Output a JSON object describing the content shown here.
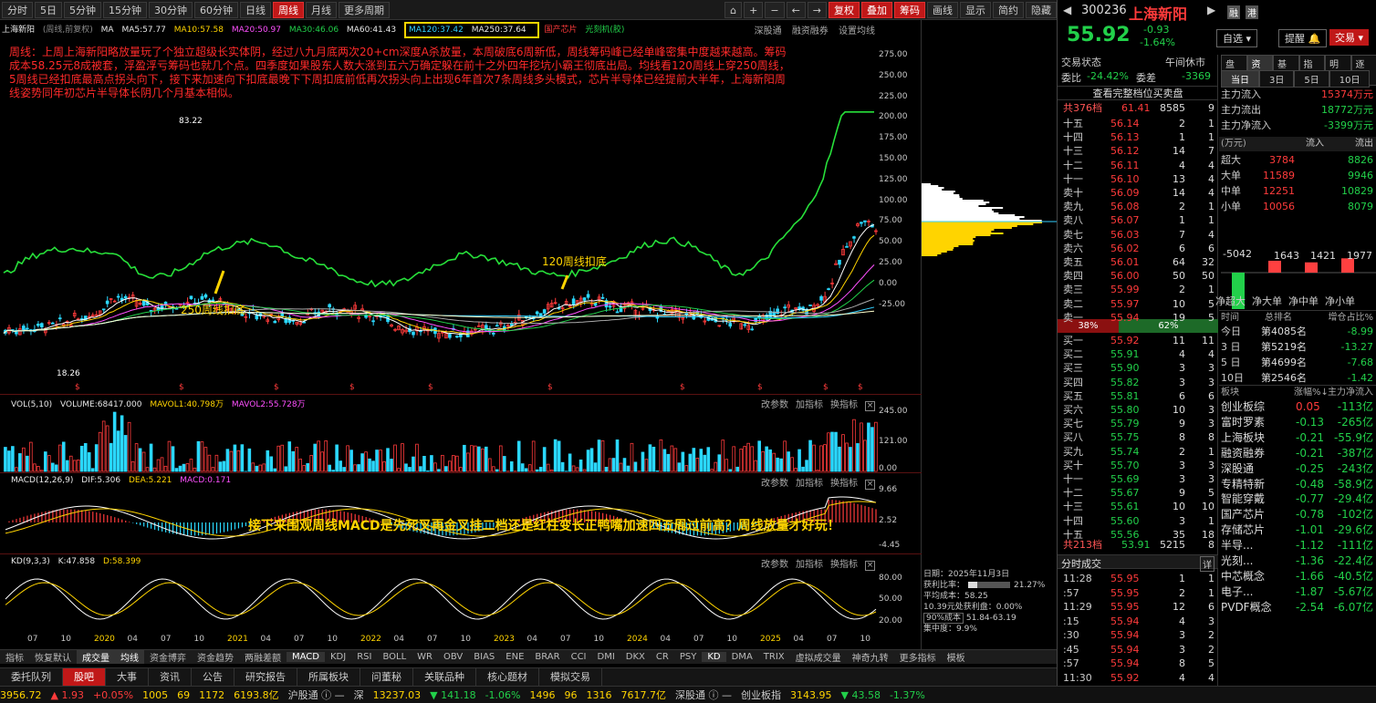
{
  "toolbar": {
    "items": [
      "分时",
      "5日",
      "5分钟",
      "15分钟",
      "30分钟",
      "60分钟",
      "日线",
      "周线",
      "月线",
      "更多周期"
    ],
    "right_items": [
      "复权",
      "叠加",
      "筹码",
      "画线",
      "显示",
      "简约",
      "隐藏"
    ]
  },
  "chart": {
    "stock_name": "上海新阳",
    "period": "(周线,前复权)",
    "ma_prefix": "MA",
    "ma5": "MA5:57.77",
    "ma10": "MA10:57.58",
    "ma20": "MA20:50.97",
    "ma30": "MA30:46.06",
    "ma60": "MA60:41.43",
    "ma120": "MA120:37.42",
    "ma250": "MA250:37.64",
    "tag1": "国产芯片",
    "tag2": "光刻机(胶)",
    "tools": [
      "深股通",
      "融资融券",
      "设置均线"
    ],
    "annotation": "周线：上周上海新阳略放量玩了个独立超级长实体阴，经过八九月底两次20+cm深度A杀放量，本周破底6周新低，周线筹码峰已经单峰密集中度越来越高。筹码成本58.25元8成被套，浮盈浮亏筹码也就几个点。四季度如果股东人数大涨到五六万确定躲在前十之外四年挖坑小霸王彻底出局。均线看120周线上穿250周线，5周线已经扣底最高点拐头向下，接下来加速向下扣底最晚下下周扣底前低再次拐头向上出现6年首次7条周线多头模式，芯片半导体已经提前大半年，上海新阳周线姿势同年初芯片半导体长阴几个月基本相似。",
    "label_250": "250周线扣底",
    "label_120": "120周线扣底",
    "high_mark": "83.22",
    "low_mark": "18.26",
    "price_ticks": [
      "275.00",
      "250.00",
      "225.00",
      "200.00",
      "175.00",
      "150.00",
      "125.00",
      "100.00",
      "75.00",
      "50.00",
      "25.00",
      "0.00",
      "-25.00"
    ]
  },
  "vol": {
    "title": "VOL(5,10)",
    "volume": "VOLUME:68417.000",
    "mavol1": "MAVOL1:40.798万",
    "mavol2": "MAVOL2:55.728万",
    "ticks": [
      "245.00",
      "121.00",
      "0.00"
    ],
    "tools": [
      "改参数",
      "加指标",
      "换指标"
    ]
  },
  "macd": {
    "title": "MACD(12,26,9)",
    "dif": "DIF:5.306",
    "dea": "DEA:5.221",
    "macd": "MACD:0.171",
    "ticks": [
      "9.66",
      "2.52",
      "-4.45"
    ],
    "annotation": "接下来围观周线MACD是先死叉再金叉挂二档还是红柱变长正鸭嘴加速四五周过前高？周线放量才好玩！"
  },
  "kd": {
    "title": "KD(9,3,3)",
    "k": "K:47.858",
    "d": "D:58.399",
    "ticks": [
      "80.00",
      "50.00",
      "20.00"
    ]
  },
  "xaxis": [
    "07",
    "10",
    "2020",
    "04",
    "07",
    "10",
    "2021",
    "04",
    "07",
    "10",
    "2022",
    "04",
    "07",
    "10",
    "2023",
    "04",
    "07",
    "10",
    "2024",
    "04",
    "07",
    "10",
    "2025",
    "04",
    "07",
    "10"
  ],
  "chip_info": {
    "date": "日期：2025年11月3日",
    "profit_label": "获利比率：",
    "profit": "21.27%",
    "avg": "平均成本：58.25",
    "profit_pct": "10.39元处获利盘：0.00%",
    "cost_label": "90%成本",
    "cost_range": "51.84-63.19",
    "conc": "集中度：9.9%"
  },
  "indicator_tabs": [
    "指标",
    "恢复默认",
    "成交量",
    "均线",
    "资金博弈",
    "资金趋势",
    "两融差额",
    "MACD",
    "KDJ",
    "RSI",
    "BOLL",
    "WR",
    "OBV",
    "BIAS",
    "ENE",
    "BRAR",
    "CCI",
    "DMI",
    "DKX",
    "CR",
    "PSY",
    "KD",
    "DMA",
    "TRIX",
    "虚拟成交量",
    "神奇九转",
    "更多指标",
    "模板"
  ],
  "news_tabs": [
    "委托队列",
    "股吧",
    "大事",
    "资讯",
    "公告",
    "研究报告",
    "所属板块",
    "问董秘",
    "关联品种",
    "核心题材",
    "模拟交易"
  ],
  "ticker": [
    "3956.72",
    "▲ 1.93",
    "+0.05%",
    "1005",
    "69",
    "1172",
    "6193.8亿",
    "沪股通 ⓘ —",
    "深",
    "13237.03",
    "▼ 141.18",
    "-1.06%",
    "1496",
    "96",
    "1316",
    "7617.7亿",
    "深股通 ⓘ —",
    "创业板指",
    "3143.95",
    "▼ 43.58",
    "-1.37%"
  ],
  "quote": {
    "code": "300236",
    "name": "上海新阳",
    "price": "55.92",
    "chg": "-0.93",
    "pct": "-1.64%",
    "b1": "融",
    "b2": "港",
    "btn_zixuan": "自选",
    "btn_tixing": "提醒",
    "btn_jiaoyi": "交易",
    "status_label": "交易状态",
    "status": "午间休市",
    "wb_label": "委比",
    "wb": "-24.42%",
    "wc_label": "委差",
    "wc": "-3369",
    "view_all": "查看完整档位买卖盘",
    "total_ask": "共376档",
    "ask_avg": "61.41",
    "ask_vol": "8585",
    "ask_n": "9",
    "total_bid": "共213档",
    "bid_avg": "53.91",
    "bid_vol": "5215",
    "bid_n": "8",
    "buy_pct": "38%",
    "sell_pct": "62%"
  },
  "asks": [
    [
      "十五",
      "56.14",
      "2",
      "1"
    ],
    [
      "十四",
      "56.13",
      "1",
      "1"
    ],
    [
      "十三",
      "56.12",
      "14",
      "7"
    ],
    [
      "十二",
      "56.11",
      "4",
      "4"
    ],
    [
      "十一",
      "56.10",
      "13",
      "4"
    ],
    [
      "卖十",
      "56.09",
      "14",
      "4"
    ],
    [
      "卖九",
      "56.08",
      "2",
      "1"
    ],
    [
      "卖八",
      "56.07",
      "1",
      "1"
    ],
    [
      "卖七",
      "56.03",
      "7",
      "4"
    ],
    [
      "卖六",
      "56.02",
      "6",
      "6"
    ],
    [
      "卖五",
      "56.01",
      "64",
      "32"
    ],
    [
      "卖四",
      "56.00",
      "50",
      "50"
    ],
    [
      "卖三",
      "55.99",
      "2",
      "1"
    ],
    [
      "卖二",
      "55.97",
      "10",
      "5"
    ],
    [
      "卖一",
      "55.94",
      "19",
      "5"
    ]
  ],
  "bids": [
    [
      "买一",
      "55.92",
      "11",
      "11"
    ],
    [
      "买二",
      "55.91",
      "4",
      "4"
    ],
    [
      "买三",
      "55.90",
      "3",
      "3"
    ],
    [
      "买四",
      "55.82",
      "3",
      "3"
    ],
    [
      "买五",
      "55.81",
      "6",
      "6"
    ],
    [
      "买六",
      "55.80",
      "10",
      "3"
    ],
    [
      "买七",
      "55.79",
      "9",
      "3"
    ],
    [
      "买八",
      "55.75",
      "8",
      "8"
    ],
    [
      "买九",
      "55.74",
      "2",
      "1"
    ],
    [
      "买十",
      "55.70",
      "3",
      "3"
    ],
    [
      "十一",
      "55.69",
      "3",
      "3"
    ],
    [
      "十二",
      "55.67",
      "9",
      "5"
    ],
    [
      "十三",
      "55.61",
      "10",
      "10"
    ],
    [
      "十四",
      "55.60",
      "3",
      "1"
    ],
    [
      "十五",
      "55.56",
      "35",
      "18"
    ]
  ],
  "ticks_title": "分时成交",
  "ticks_more": "详",
  "trades": [
    [
      "11:28",
      "55.95",
      "1",
      "1"
    ],
    [
      ":57",
      "55.95",
      "2",
      "1"
    ],
    [
      "11:29",
      "55.95",
      "12",
      "6"
    ],
    [
      ":15",
      "55.94",
      "4",
      "3"
    ],
    [
      ":30",
      "55.94",
      "3",
      "2"
    ],
    [
      ":45",
      "55.94",
      "3",
      "2"
    ],
    [
      ":57",
      "55.94",
      "8",
      "5"
    ],
    [
      "11:30",
      "55.92",
      "4",
      "4"
    ]
  ],
  "ff": {
    "tabs": [
      "盘口",
      "资金",
      "基本",
      "指数",
      "明细",
      "逐笔"
    ],
    "days": [
      "当日",
      "3日",
      "5日",
      "10日"
    ],
    "in_label": "主力流入",
    "in": "15374万元",
    "out_label": "主力流出",
    "out": "18772万元",
    "net_label": "主力净流入",
    "net": "-3399万元",
    "unit": "(万元)",
    "col_in": "流入",
    "col_out": "流出",
    "rows": [
      [
        "超大",
        "3784",
        "8826"
      ],
      [
        "大单",
        "11589",
        "9946"
      ],
      [
        "中单",
        "12251",
        "10829"
      ],
      [
        "小单",
        "10056",
        "8079"
      ]
    ],
    "bars": [
      [
        "-5042",
        "净超大"
      ],
      [
        "1643",
        "净大单"
      ],
      [
        "1421",
        "净中单"
      ],
      [
        "1977",
        "净小单"
      ]
    ],
    "rank_h": [
      "时间",
      "总排名",
      "增仓占比%"
    ],
    "ranks": [
      [
        "今日",
        "第4085名",
        "-8.99"
      ],
      [
        "3 日",
        "第5219名",
        "-13.27"
      ],
      [
        "5 日",
        "第4699名",
        "-7.68"
      ],
      [
        "10日",
        "第2546名",
        "-1.42"
      ]
    ],
    "sec_h": [
      "板块",
      "涨幅%↓",
      "主力净流入"
    ],
    "sectors": [
      [
        "创业板综",
        "0.05",
        "-113亿"
      ],
      [
        "富时罗素",
        "-0.13",
        "-265亿"
      ],
      [
        "上海板块",
        "-0.21",
        "-55.9亿"
      ],
      [
        "融资融券",
        "-0.21",
        "-387亿"
      ],
      [
        "深股通",
        "-0.25",
        "-243亿"
      ],
      [
        "专精特新",
        "-0.48",
        "-58.9亿"
      ],
      [
        "智能穿戴",
        "-0.77",
        "-29.4亿"
      ],
      [
        "国产芯片",
        "-0.78",
        "-102亿"
      ],
      [
        "存储芯片",
        "-1.01",
        "-29.6亿"
      ],
      [
        "半导...",
        "-1.12",
        "-111亿"
      ],
      [
        "光刻...",
        "-1.36",
        "-22.4亿"
      ],
      [
        "中芯概念",
        "-1.66",
        "-40.5亿"
      ],
      [
        "电子...",
        "-1.87",
        "-5.67亿"
      ],
      [
        "PVDF概念",
        "-2.54",
        "-6.07亿"
      ]
    ]
  }
}
